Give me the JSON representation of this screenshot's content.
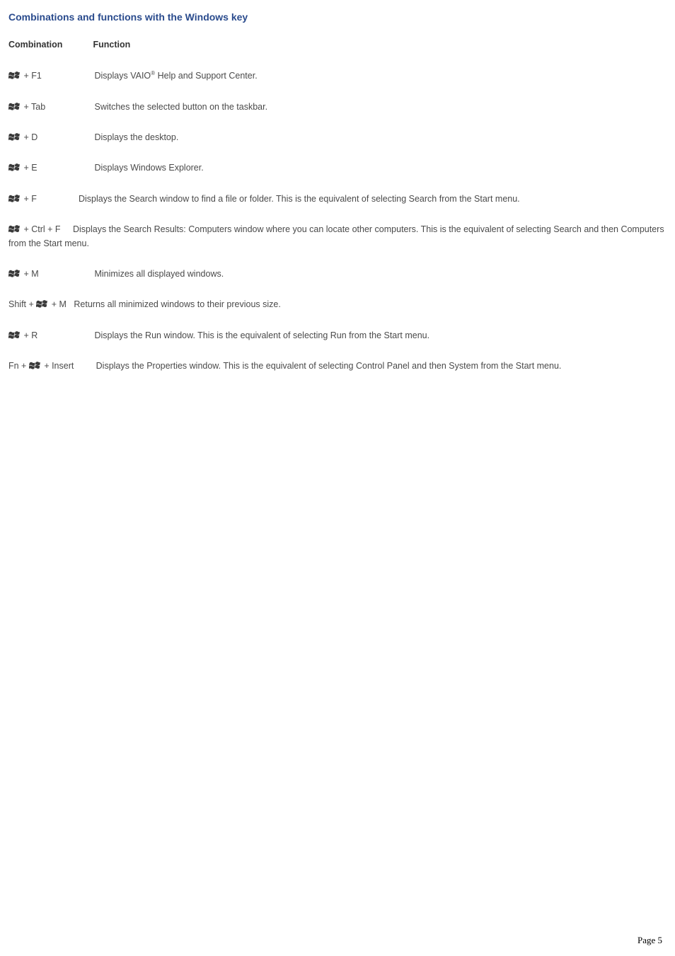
{
  "title": "Combinations and functions with the Windows key",
  "header": {
    "combination": "Combination",
    "function": "Function"
  },
  "rows": [
    {
      "key_suffix": " + F1",
      "desc_pre": "Displays VAIO",
      "desc_sup": "®",
      "desc_post": " Help and Support Center."
    },
    {
      "key_suffix": " + Tab",
      "desc": "Switches the selected button on the taskbar."
    },
    {
      "key_suffix": " + D",
      "desc": "Displays the desktop."
    },
    {
      "key_suffix": " + E",
      "desc": "Displays Windows Explorer."
    },
    {
      "key_suffix": " + F",
      "desc": "Displays the Search window to find a file or folder. This is the equivalent of selecting Search from the Start menu."
    },
    {
      "key_suffix": " + Ctrl + F",
      "desc": "Displays the Search Results: Computers window where you can locate other computers. This is the equivalent of selecting Search and then Computers from the Start menu."
    },
    {
      "key_suffix": " + M",
      "desc": "Minimizes all displayed windows."
    },
    {
      "key_prefix": "Shift + ",
      "key_suffix": " + M",
      "desc": "Returns all minimized windows to their previous size."
    },
    {
      "key_suffix": " + R",
      "desc": "Displays the Run window. This is the equivalent of selecting Run from the Start menu."
    },
    {
      "key_prefix": "Fn + ",
      "key_suffix": " + Insert",
      "desc": "Displays the Properties window. This is the equivalent of selecting Control Panel and then System from the Start menu."
    }
  ],
  "footer": {
    "label": "Page ",
    "number": "5"
  }
}
